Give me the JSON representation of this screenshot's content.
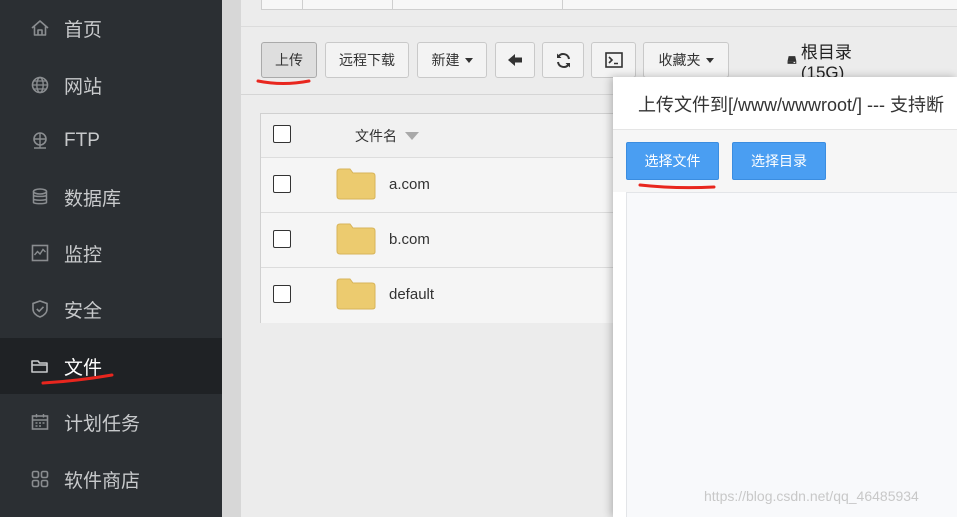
{
  "sidebar": {
    "items": [
      {
        "label": "首页",
        "icon": "home-icon"
      },
      {
        "label": "网站",
        "icon": "globe-icon"
      },
      {
        "label": "FTP",
        "icon": "ftp-icon"
      },
      {
        "label": "数据库",
        "icon": "database-icon"
      },
      {
        "label": "监控",
        "icon": "monitor-icon"
      },
      {
        "label": "安全",
        "icon": "shield-icon"
      },
      {
        "label": "文件",
        "icon": "folder-icon",
        "active": true
      },
      {
        "label": "计划任务",
        "icon": "calendar-icon"
      },
      {
        "label": "软件商店",
        "icon": "grid-icon"
      }
    ]
  },
  "toolbar": {
    "upload": "上传",
    "remote_download": "远程下载",
    "new": "新建",
    "favorites": "收藏夹",
    "root_dir": "根目录(15G)"
  },
  "file_table": {
    "header_name": "文件名",
    "rows": [
      {
        "name": "a.com"
      },
      {
        "name": "b.com"
      },
      {
        "name": "default"
      }
    ]
  },
  "dialog": {
    "title": "上传文件到[/www/wwwroot/] --- 支持断",
    "choose_file": "选择文件",
    "choose_dir": "选择目录"
  },
  "watermark": "https://blog.csdn.net/qq_46485934",
  "colors": {
    "sidebar_bg": "#2b2f33",
    "primary": "#4a9ef2",
    "annotation": "#e8261e",
    "folder": "#eccb6f"
  }
}
